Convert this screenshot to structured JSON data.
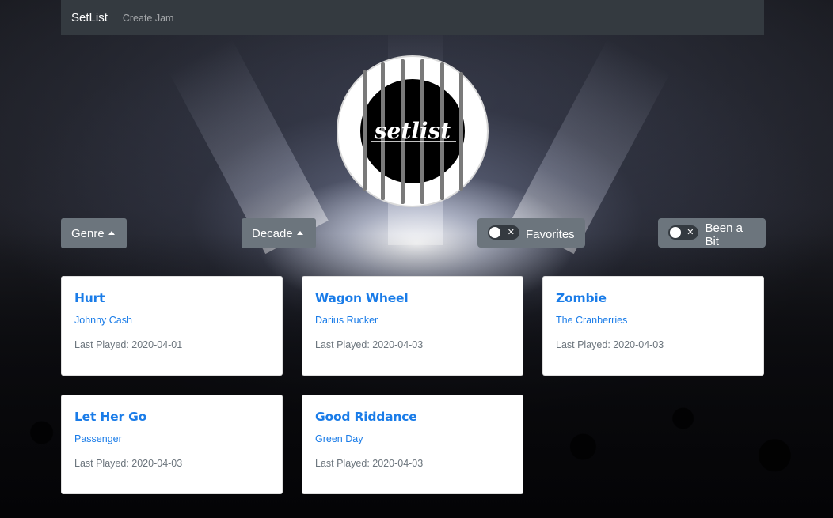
{
  "navbar": {
    "brand": "SetList",
    "links": [
      "Create Jam"
    ]
  },
  "logo": {
    "text": "setlist",
    "alt": "setlist-logo"
  },
  "filters": {
    "genre_label": "Genre",
    "decade_label": "Decade",
    "favorites_label": "Favorites",
    "been_a_bit_label": "Been a Bit",
    "favorites_on": false,
    "been_a_bit_on": false
  },
  "songs": [
    {
      "title": "Hurt",
      "artist": "Johnny Cash",
      "last_played": "Last Played: 2020-04-01"
    },
    {
      "title": "Wagon Wheel",
      "artist": "Darius Rucker",
      "last_played": "Last Played: 2020-04-03"
    },
    {
      "title": "Zombie",
      "artist": "The Cranberries",
      "last_played": "Last Played: 2020-04-03"
    },
    {
      "title": "Let Her Go",
      "artist": "Passenger",
      "last_played": "Last Played: 2020-04-03"
    },
    {
      "title": "Good Riddance",
      "artist": "Green Day",
      "last_played": "Last Played: 2020-04-03"
    }
  ],
  "colors": {
    "navbar": "#343a40",
    "button": "#6c757d",
    "link": "#1a7ce8",
    "muted": "#6c757d"
  }
}
